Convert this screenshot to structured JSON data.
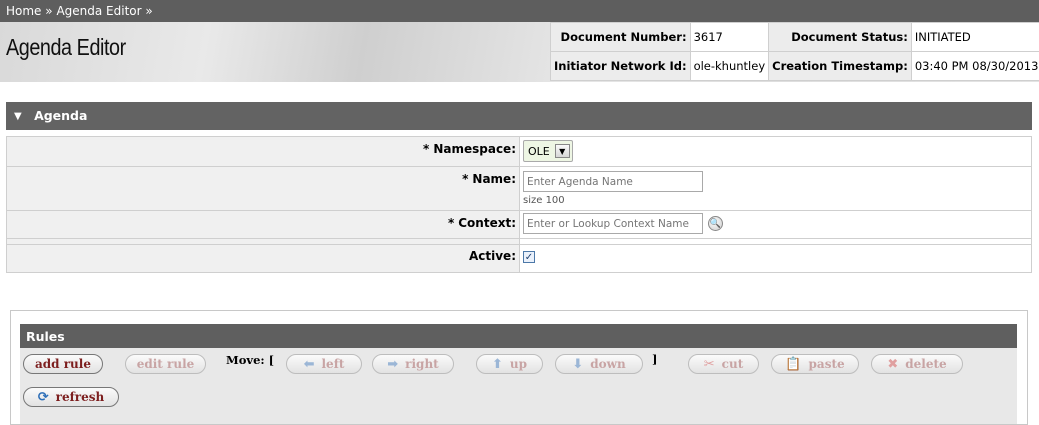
{
  "breadcrumb": {
    "home": "Home",
    "sep1": "»",
    "current": "Agenda Editor",
    "sep2": "»"
  },
  "header": {
    "title": "Agenda Editor"
  },
  "document_info": {
    "number_label": "Document Number:",
    "number_value": "3617",
    "status_label": "Document Status:",
    "status_value": "INITIATED",
    "initiator_label": "Initiator Network Id:",
    "initiator_value": "ole-khuntley",
    "timestamp_label": "Creation Timestamp:",
    "timestamp_value": "03:40 PM 08/30/2013"
  },
  "agenda_section": {
    "toggle_icon": "triangle-down-icon",
    "title": "Agenda",
    "required_marker": "*",
    "namespace_label": "Namespace:",
    "namespace_value": "OLE",
    "name_label": "Name:",
    "name_placeholder": "Enter Agenda Name",
    "name_hint": "size 100",
    "context_label": "Context:",
    "context_placeholder": "Enter or Lookup Context Name",
    "active_label": "Active:",
    "active_checked": true
  },
  "rules_section": {
    "title": "Rules",
    "add_rule": "add rule",
    "edit_rule": "edit rule",
    "move_label": "Move: [",
    "move_close": "]",
    "left": "left",
    "right": "right",
    "up": "up",
    "down": "down",
    "cut": "cut",
    "paste": "paste",
    "delete": "delete",
    "refresh": "refresh"
  },
  "colors": {
    "header_bar": "#5e5e5e",
    "enabled_button_text": "#7d1f1f",
    "disabled_button_text": "#c8a4a4"
  }
}
